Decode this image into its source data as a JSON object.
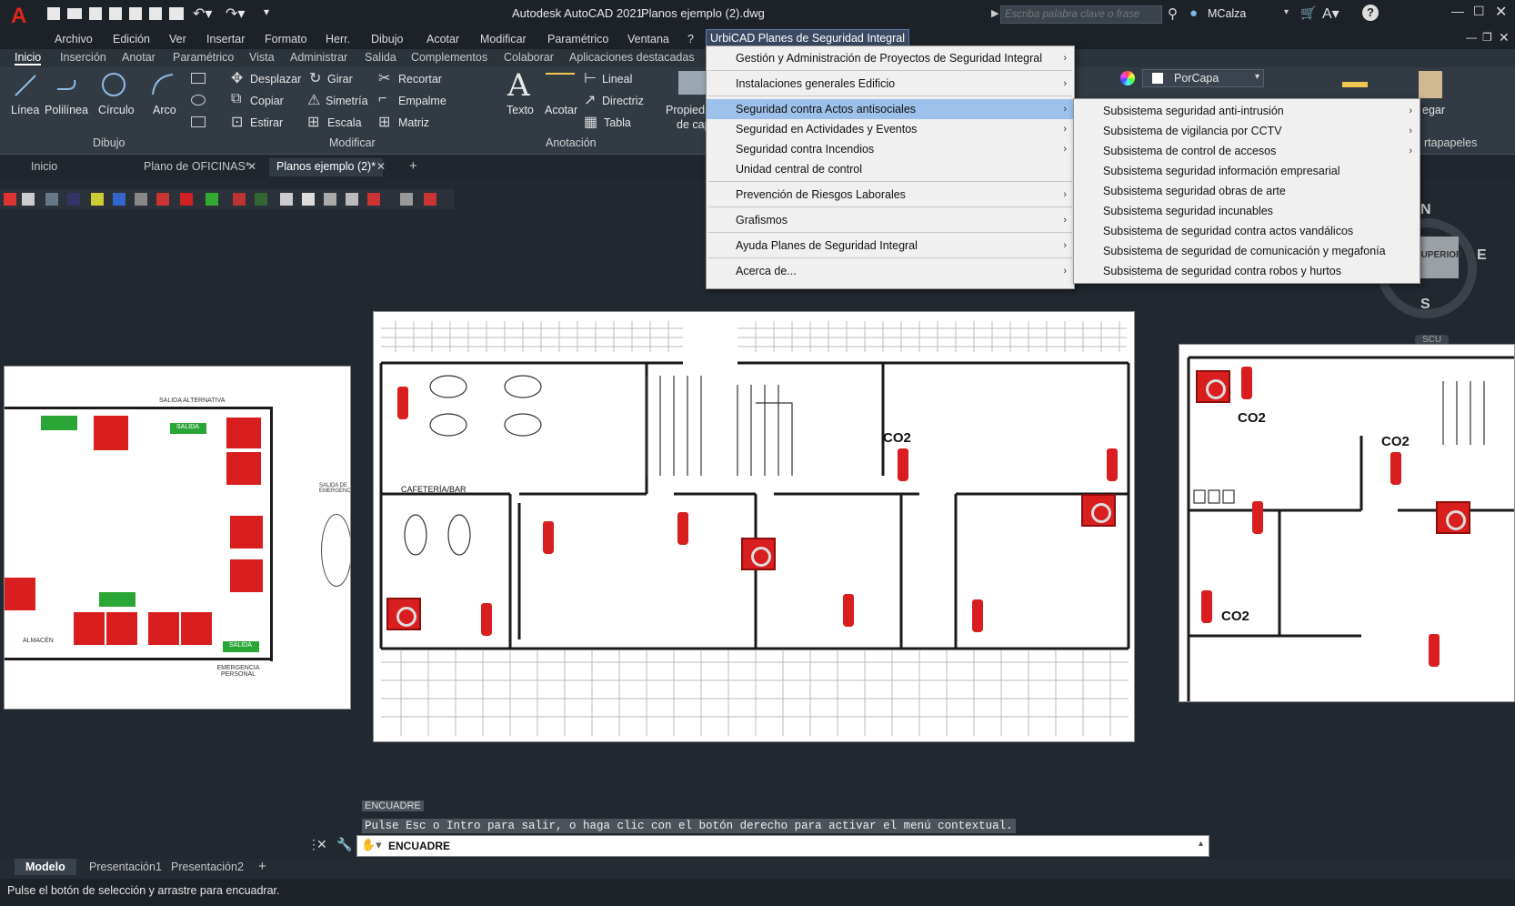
{
  "app": {
    "logo": "A",
    "title": "Autodesk AutoCAD 2021",
    "filename": "Planos ejemplo (2).dwg",
    "search_placeholder": "Escriba palabra clave o frase",
    "user": "MCalza"
  },
  "menubar": [
    "Archivo",
    "Edición",
    "Ver",
    "Insertar",
    "Formato",
    "Herr.",
    "Dibujo",
    "Acotar",
    "Modificar",
    "Paramétrico",
    "Ventana",
    "?",
    "UrbiCAD Planes de Seguridad Integral"
  ],
  "ribbon_tabs": [
    "Inicio",
    "Inserción",
    "Anotar",
    "Paramétrico",
    "Vista",
    "Administrar",
    "Salida",
    "Complementos",
    "Colaborar",
    "Aplicaciones destacadas"
  ],
  "ribbon": {
    "draw": {
      "linea": "Línea",
      "polilinea": "Polilínea",
      "circulo": "Círculo",
      "arco": "Arco",
      "panel": "Dibujo"
    },
    "modify": {
      "desplazar": "Desplazar",
      "girar": "Girar",
      "recortar": "Recortar",
      "copiar": "Copiar",
      "simetria": "Simetría",
      "empalme": "Empalme",
      "estirar": "Estirar",
      "escala": "Escala",
      "matriz": "Matriz",
      "panel": "Modificar"
    },
    "annotation": {
      "texto": "Texto",
      "acotar": "Acotar",
      "lineal": "Lineal",
      "directriz": "Directriz",
      "tabla": "Tabla",
      "panel": "Anotación"
    },
    "props": {
      "propiedades": "Propied",
      "decapa": "de cap",
      "porcapa": "PorCapa",
      "pegar": "egar",
      "portapapeles": "rtapapeles"
    }
  },
  "doc_tabs": [
    "Inicio",
    "Plano de OFICINAS*",
    "Planos ejemplo (2)*"
  ],
  "dropdown_main": {
    "items": [
      "Gestión y Administración de Proyectos de Seguridad Integral",
      "Instalaciones generales Edificio",
      "Seguridad contra Actos antisociales",
      "Seguridad en Actividades y Eventos",
      "Seguridad contra Incendios",
      "Unidad central de control",
      "Prevención de Riesgos Laborales",
      "Grafismos",
      "Ayuda Planes de Seguridad Integral",
      "Acerca de..."
    ]
  },
  "dropdown_sub": {
    "items": [
      "Subsistema seguridad anti-intrusión",
      "Subsistema de vigilancia por CCTV",
      "Subsistema de control de accesos",
      "Subsistema seguridad información empresarial",
      "Subsistema seguridad obras de arte",
      "Subsistema seguridad incunables",
      "Subsistema de seguridad contra actos vandálicos",
      "Subsistema de seguridad de comunicación y megafonía",
      "Subsistema de seguridad contra robos y hurtos"
    ]
  },
  "viewcube": {
    "n": "N",
    "e": "E",
    "s": "S",
    "face": "SUPERIOR",
    "wcs": "SCU"
  },
  "drawing": {
    "cafeteria": "CAFETERÍA/BAR",
    "co2": "CO2",
    "salida": "SALIDA",
    "small_labels": [
      "SALIDA ALTERNATIVA",
      "SALIDA DE EMERGENCIA",
      "SALIDA",
      "EMERGENCIA PERSONAL",
      "ALMACÉN"
    ]
  },
  "command": {
    "prompt_label": "ENCUADRE",
    "message": "Pulse Esc o Intro para salir, o haga clic con el botón derecho para activar el menú contextual.",
    "input_value": "ENCUADRE"
  },
  "layout_tabs": [
    "Modelo",
    "Presentación1",
    "Presentación2"
  ],
  "status_message": "Pulse el botón de selección y arrastre para encuadrar.",
  "colors": {
    "accent": "#c81e1e",
    "highlight": "#9dc1ea",
    "bg": "#212830"
  }
}
